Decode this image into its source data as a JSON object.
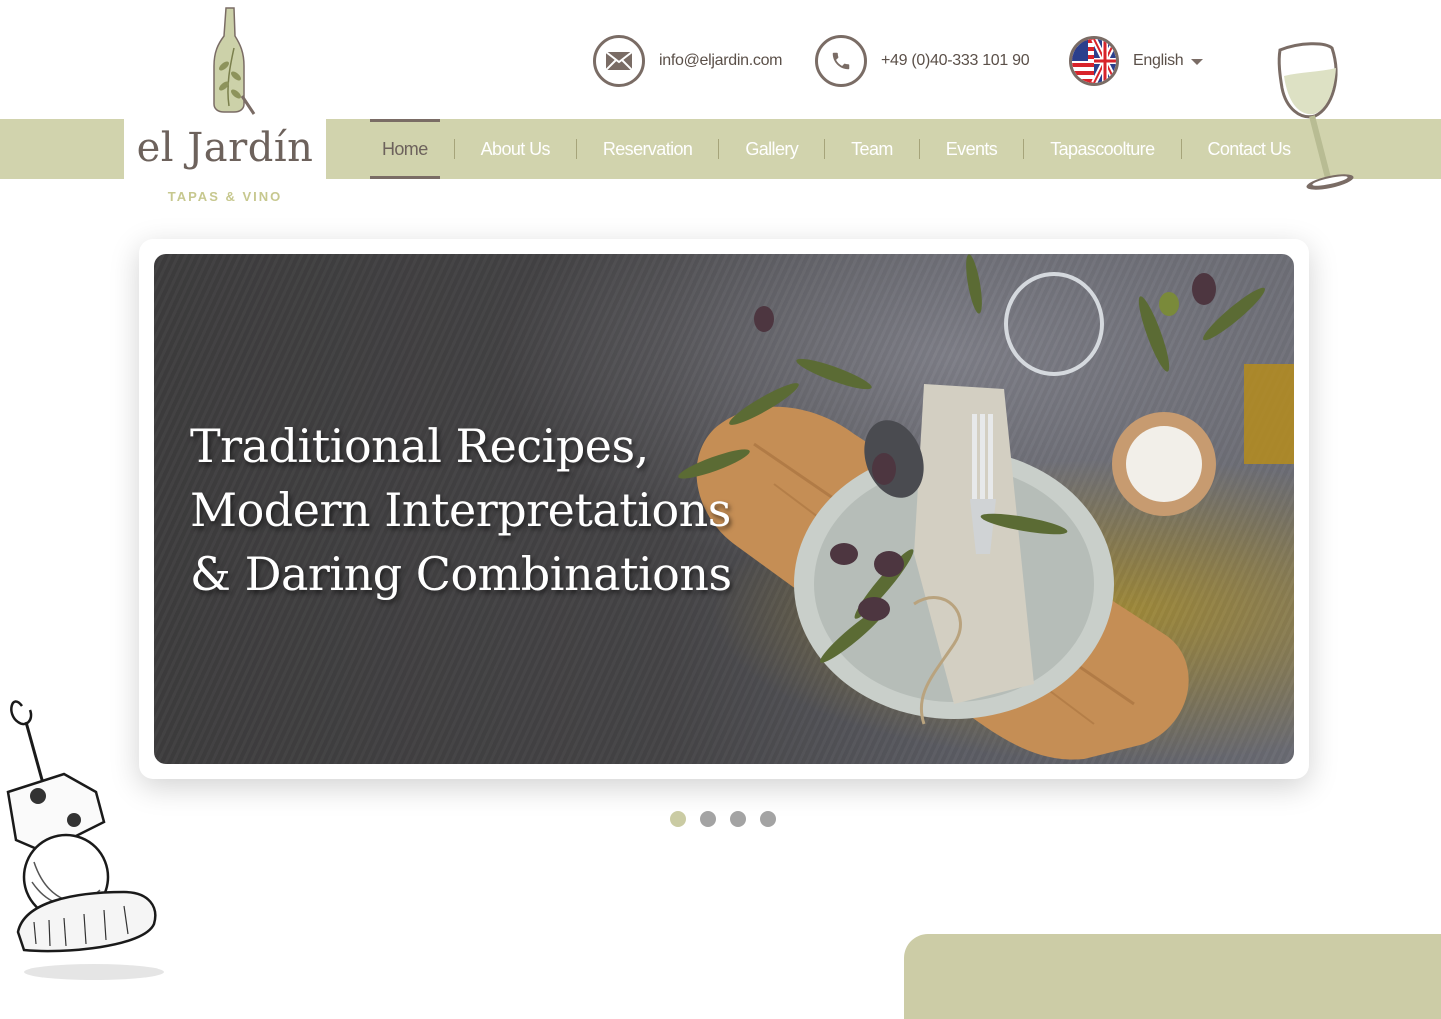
{
  "brand": {
    "name": "el Jardín",
    "tagline": "TAPAS & VINO"
  },
  "contact": {
    "email": "info@eljardin.com",
    "phone": "+49 (0)40-333 101 90",
    "language": "English"
  },
  "icons": {
    "email": "envelope-icon",
    "phone": "phone-icon",
    "language": "flag-us-uk-icon",
    "language_caret": "caret-down-icon"
  },
  "nav": {
    "items": [
      {
        "label": "Home",
        "active": true
      },
      {
        "label": "About Us",
        "active": false
      },
      {
        "label": "Reservation",
        "active": false
      },
      {
        "label": "Gallery",
        "active": false
      },
      {
        "label": "Team",
        "active": false
      },
      {
        "label": "Events",
        "active": false
      },
      {
        "label": "Tapascoolture",
        "active": false
      },
      {
        "label": "Contact Us",
        "active": false
      }
    ]
  },
  "hero": {
    "headline_lines": [
      "Traditional Recipes,",
      "Modern Interpretations",
      "& Daring Combinations"
    ],
    "slides_total": 4,
    "active_slide": 1
  },
  "colors": {
    "accent_green": "#d1d3ad",
    "brand_brown": "#6d625c",
    "dot_active": "#cacba3",
    "dot_inactive": "#a3a3a3",
    "panel_green": "#cccca6"
  }
}
